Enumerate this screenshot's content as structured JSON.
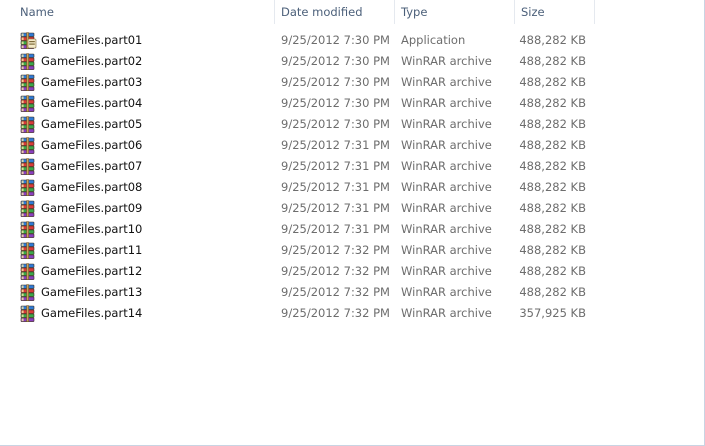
{
  "columns": {
    "name": "Name",
    "date": "Date modified",
    "type": "Type",
    "size": "Size"
  },
  "sort": {
    "column": "name",
    "direction": "ascending",
    "icon": "sort-up-icon"
  },
  "icons": {
    "application": "winrar-sfx-icon",
    "archive": "winrar-archive-icon"
  },
  "files": [
    {
      "name": "GameFiles.part01",
      "date": "9/25/2012 7:30 PM",
      "type": "Application",
      "size": "488,282 KB",
      "icon": "application"
    },
    {
      "name": "GameFiles.part02",
      "date": "9/25/2012 7:30 PM",
      "type": "WinRAR archive",
      "size": "488,282 KB",
      "icon": "archive"
    },
    {
      "name": "GameFiles.part03",
      "date": "9/25/2012 7:30 PM",
      "type": "WinRAR archive",
      "size": "488,282 KB",
      "icon": "archive"
    },
    {
      "name": "GameFiles.part04",
      "date": "9/25/2012 7:30 PM",
      "type": "WinRAR archive",
      "size": "488,282 KB",
      "icon": "archive"
    },
    {
      "name": "GameFiles.part05",
      "date": "9/25/2012 7:30 PM",
      "type": "WinRAR archive",
      "size": "488,282 KB",
      "icon": "archive"
    },
    {
      "name": "GameFiles.part06",
      "date": "9/25/2012 7:31 PM",
      "type": "WinRAR archive",
      "size": "488,282 KB",
      "icon": "archive"
    },
    {
      "name": "GameFiles.part07",
      "date": "9/25/2012 7:31 PM",
      "type": "WinRAR archive",
      "size": "488,282 KB",
      "icon": "archive"
    },
    {
      "name": "GameFiles.part08",
      "date": "9/25/2012 7:31 PM",
      "type": "WinRAR archive",
      "size": "488,282 KB",
      "icon": "archive"
    },
    {
      "name": "GameFiles.part09",
      "date": "9/25/2012 7:31 PM",
      "type": "WinRAR archive",
      "size": "488,282 KB",
      "icon": "archive"
    },
    {
      "name": "GameFiles.part10",
      "date": "9/25/2012 7:31 PM",
      "type": "WinRAR archive",
      "size": "488,282 KB",
      "icon": "archive"
    },
    {
      "name": "GameFiles.part11",
      "date": "9/25/2012 7:32 PM",
      "type": "WinRAR archive",
      "size": "488,282 KB",
      "icon": "archive"
    },
    {
      "name": "GameFiles.part12",
      "date": "9/25/2012 7:32 PM",
      "type": "WinRAR archive",
      "size": "488,282 KB",
      "icon": "archive"
    },
    {
      "name": "GameFiles.part13",
      "date": "9/25/2012 7:32 PM",
      "type": "WinRAR archive",
      "size": "488,282 KB",
      "icon": "archive"
    },
    {
      "name": "GameFiles.part14",
      "date": "9/25/2012 7:32 PM",
      "type": "WinRAR archive",
      "size": "357,925 KB",
      "icon": "archive"
    }
  ]
}
